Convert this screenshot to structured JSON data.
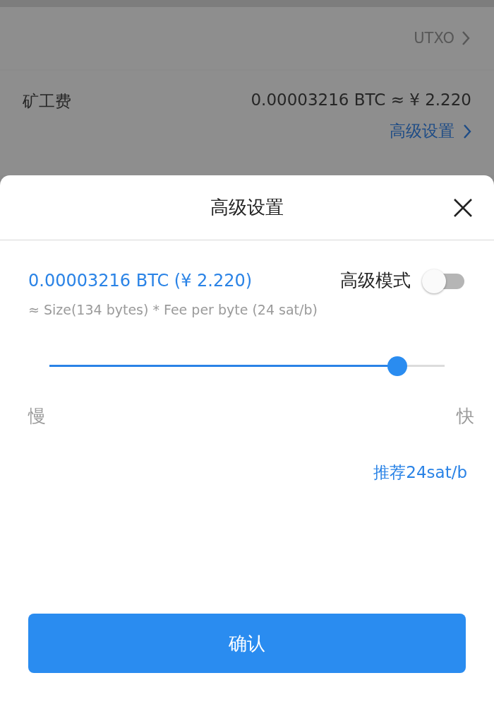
{
  "background": {
    "utxo_link": "UTXO",
    "fee_row": {
      "label": "矿工费",
      "value": "0.00003216 BTC ≈ ¥ 2.220",
      "advanced_link": "高级设置"
    }
  },
  "sheet": {
    "title": "高级设置",
    "fee": "0.00003216 BTC (¥ 2.220)",
    "advanced_mode": {
      "label": "高级模式",
      "on": false
    },
    "formula": "≈ Size(134 bytes) * Fee per byte (24 sat/b)",
    "slider": {
      "level": 0.88,
      "slow": "慢",
      "fast": "快"
    },
    "recommended": "推荐24sat/b",
    "confirm": "确认"
  }
}
